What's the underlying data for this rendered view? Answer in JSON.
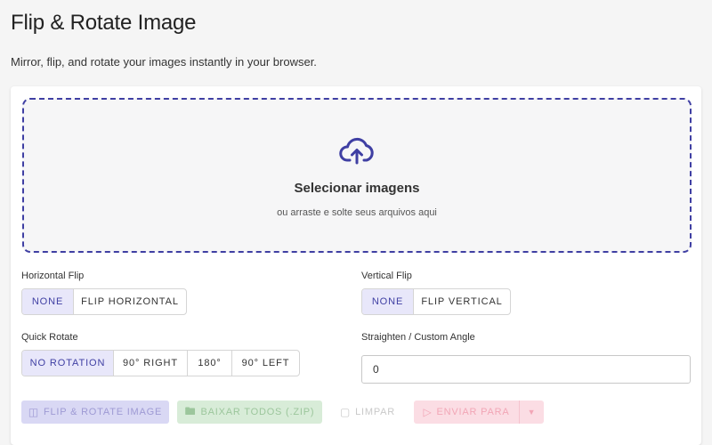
{
  "header": {
    "title": "Flip & Rotate Image",
    "subtitle": "Mirror, flip, and rotate your images instantly in your browser."
  },
  "dropzone": {
    "title": "Selecionar imagens",
    "subtitle": "ou arraste e solte seus arquivos aqui",
    "icon": "cloud-upload-icon"
  },
  "horizontal_flip": {
    "label": "Horizontal Flip",
    "options": [
      "NONE",
      "FLIP HORIZONTAL"
    ],
    "selected": "NONE"
  },
  "vertical_flip": {
    "label": "Vertical Flip",
    "options": [
      "NONE",
      "FLIP VERTICAL"
    ],
    "selected": "NONE"
  },
  "quick_rotate": {
    "label": "Quick Rotate",
    "options": [
      "NO ROTATION",
      "90° RIGHT",
      "180°",
      "90° LEFT"
    ],
    "selected": "NO ROTATION"
  },
  "custom_angle": {
    "label": "Straighten / Custom Angle",
    "value": "0"
  },
  "actions": {
    "flip_rotate": "FLIP & ROTATE IMAGE",
    "download_zip": "BAIXAR TODOS (.ZIP)",
    "clear": "LIMPAR",
    "send_to": "ENVIAR PARA"
  },
  "colors": {
    "accent": "#3f3fa3",
    "active_bg": "#e8e7fa"
  }
}
